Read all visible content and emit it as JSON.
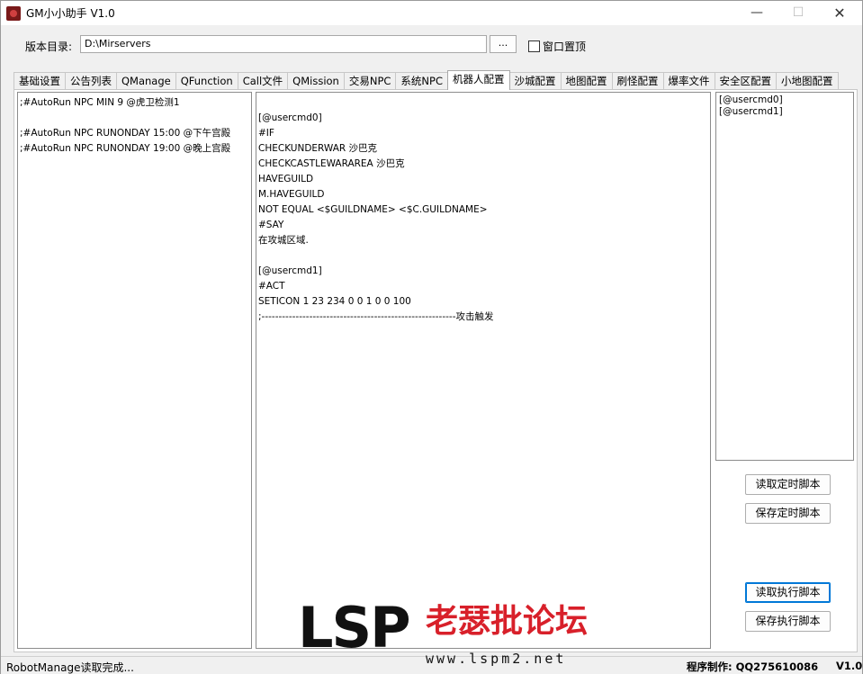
{
  "window": {
    "title": "GM小小助手 V1.0",
    "controls": {
      "minimize": "—",
      "maximize": "☐",
      "close": "✕"
    }
  },
  "toolbar": {
    "dir_label": "版本目录:",
    "dir_value": "D:\\Mirservers",
    "browse_label": "...",
    "topmost_label": "窗口置顶",
    "topmost_checked": false
  },
  "tabs": [
    {
      "label": "基础设置",
      "active": false
    },
    {
      "label": "公告列表",
      "active": false
    },
    {
      "label": "QManage",
      "active": false
    },
    {
      "label": "QFunction",
      "active": false
    },
    {
      "label": "Call文件",
      "active": false
    },
    {
      "label": "QMission",
      "active": false
    },
    {
      "label": "交易NPC",
      "active": false
    },
    {
      "label": "系统NPC",
      "active": false
    },
    {
      "label": "机器人配置",
      "active": true
    },
    {
      "label": "沙城配置",
      "active": false
    },
    {
      "label": "地图配置",
      "active": false
    },
    {
      "label": "刷怪配置",
      "active": false
    },
    {
      "label": "爆率文件",
      "active": false
    },
    {
      "label": "安全区配置",
      "active": false
    },
    {
      "label": "小地图配置",
      "active": false
    }
  ],
  "left_editor": {
    "lines": [
      ";#AutoRun NPC MIN 9 @虎卫检测1",
      "",
      ";#AutoRun NPC RUNONDAY 15:00 @下午宫殿",
      ";#AutoRun NPC RUNONDAY 19:00 @晚上宫殿"
    ]
  },
  "middle_editor": {
    "lines": [
      "",
      "[@usercmd0]",
      "#IF",
      "CHECKUNDERWAR 沙巴克",
      "CHECKCASTLEWARAREA 沙巴克",
      "HAVEGUILD",
      "M.HAVEGUILD",
      "NOT EQUAL <$GUILDNAME> <$C.GUILDNAME>",
      "#SAY",
      "在攻城区域.",
      "",
      "[@usercmd1]",
      "#ACT",
      "SETICON 1 23 234 0 0 1 0 0 100",
      ";---------------------------------------------------------攻击触发"
    ]
  },
  "right_list": {
    "items": [
      "[@usercmd0]",
      "[@usercmd1]"
    ]
  },
  "buttons": {
    "read_timer": "读取定时脚本",
    "save_timer": "保存定时脚本",
    "read_exec": "读取执行脚本",
    "save_exec": "保存执行脚本"
  },
  "status": {
    "message": "RobotManage读取完成...",
    "author": "程序制作:  QQ275610086",
    "version": "V1.0"
  },
  "watermark": {
    "logo_letters": "LSP",
    "logo_cn": "老瑟批论坛",
    "url": "www.lspm2.net"
  }
}
